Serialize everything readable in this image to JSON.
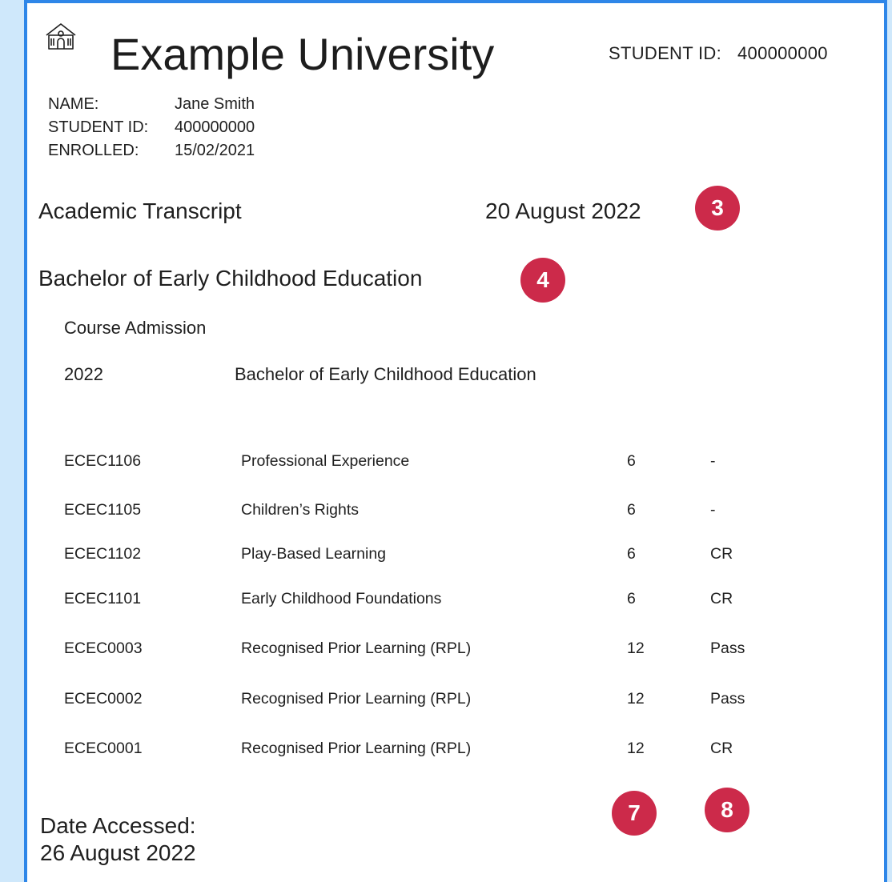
{
  "header": {
    "university_name": "Example University",
    "icon": "university-building-icon",
    "student_id_label": "STUDENT ID:",
    "student_id_value": "400000000"
  },
  "student_info": {
    "name_label": "NAME:",
    "name_value": "Jane Smith",
    "id_label": "STUDENT ID:",
    "id_value": "400000000",
    "enrolled_label": "ENROLLED:",
    "enrolled_value": "15/02/2021"
  },
  "transcript": {
    "title": "Academic Transcript",
    "date": "20 August 2022",
    "degree": "Bachelor of Early Childhood Education",
    "admission_heading": "Course Admission",
    "admission_year": "2022",
    "admission_program": "Bachelor of Early Childhood Education"
  },
  "courses": [
    {
      "code": "ECEC1106",
      "title": "Professional Experience",
      "credits": "6",
      "grade": "-"
    },
    {
      "code": "ECEC1105",
      "title": "Children’s Rights",
      "credits": "6",
      "grade": "-"
    },
    {
      "code": "ECEC1102",
      "title": "Play-Based Learning",
      "credits": "6",
      "grade": "CR"
    },
    {
      "code": "ECEC1101",
      "title": "Early Childhood Foundations",
      "credits": "6",
      "grade": "CR"
    },
    {
      "code": "ECEC0003",
      "title": "Recognised Prior Learning (RPL)",
      "credits": "12",
      "grade": "Pass"
    },
    {
      "code": "ECEC0002",
      "title": "Recognised Prior Learning (RPL)",
      "credits": "12",
      "grade": "Pass"
    },
    {
      "code": "ECEC0001",
      "title": "Recognised Prior Learning (RPL)",
      "credits": "12",
      "grade": "CR"
    }
  ],
  "markers": {
    "m3": "3",
    "m4": "4",
    "m7": "7",
    "m8": "8"
  },
  "footer": {
    "accessed_label": "Date Accessed:",
    "accessed_date": "26 August 2022"
  },
  "colors": {
    "page_background": "#cfe8fb",
    "border": "#2e86e8",
    "marker": "#cc2a4a"
  }
}
